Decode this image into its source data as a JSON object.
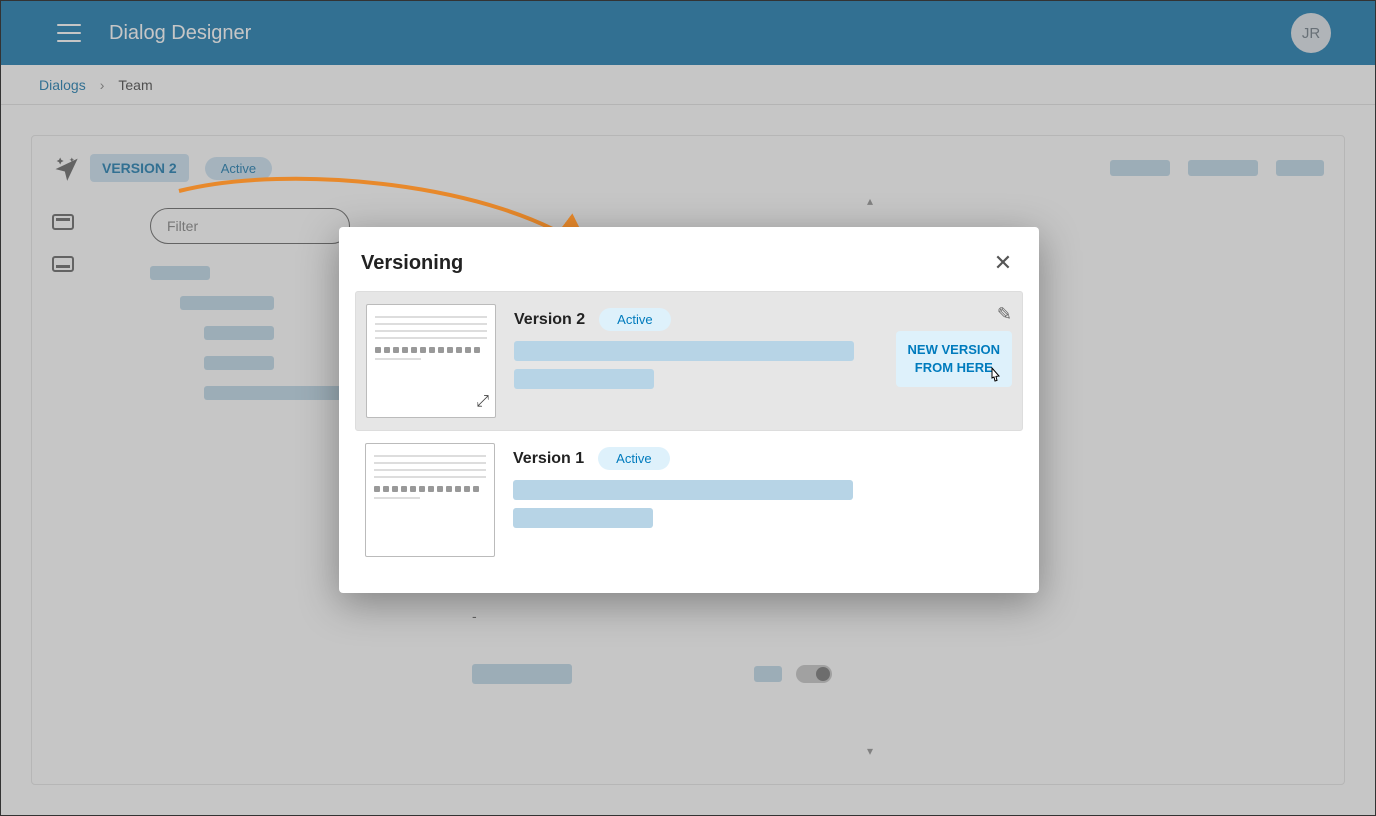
{
  "header": {
    "app_title": "Dialog Designer",
    "avatar_initials": "JR"
  },
  "breadcrumb": {
    "root": "Dialogs",
    "current": "Team"
  },
  "toolbar": {
    "version_label": "VERSION 2",
    "status": "Active"
  },
  "filter": {
    "placeholder": "Filter"
  },
  "modal": {
    "title": "Versioning",
    "versions": [
      {
        "name": "Version 2",
        "status": "Active",
        "action_line1": "NEW VERSION",
        "action_line2": "FROM HERE"
      },
      {
        "name": "Version 1",
        "status": "Active"
      }
    ]
  },
  "misc": {
    "dash": "-"
  }
}
